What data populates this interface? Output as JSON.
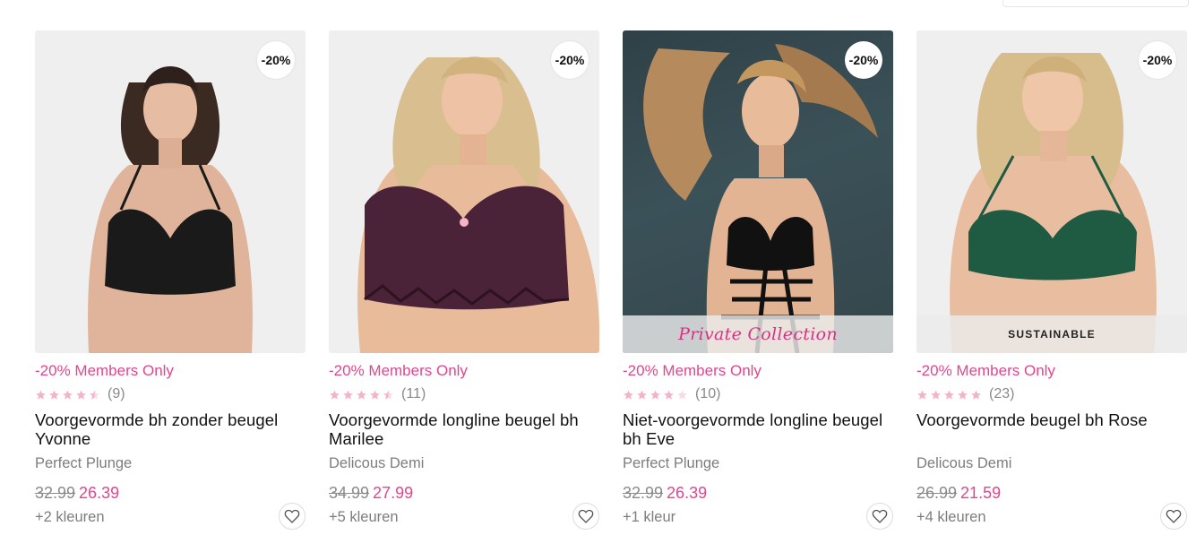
{
  "products": [
    {
      "badge": "-20%",
      "banner": "",
      "promo": "-20% Members Only",
      "rating": 4.5,
      "review_count": "(9)",
      "name": "Voorgevormde bh zonder beugel Yvonne",
      "collection": "Perfect Plunge",
      "old_price": "32.99",
      "new_price": "26.39",
      "colors": "+2 kleuren",
      "bra_color": "#1a1a1a"
    },
    {
      "badge": "-20%",
      "banner": "",
      "promo": "-20% Members Only",
      "rating": 4.5,
      "review_count": "(11)",
      "name": "Voorgevormde longline beugel bh Marilee",
      "collection": "Delicous Demi",
      "old_price": "34.99",
      "new_price": "27.99",
      "colors": "+5 kleuren",
      "bra_color": "#4a2338"
    },
    {
      "badge": "-20%",
      "banner": "Private Collection",
      "promo": "-20% Members Only",
      "rating": 4,
      "review_count": "(10)",
      "name": "Niet-voorgevormde longline beugel bh Eve",
      "collection": "Perfect Plunge",
      "old_price": "32.99",
      "new_price": "26.39",
      "colors": "+1 kleur",
      "bra_color": "#111111"
    },
    {
      "badge": "-20%",
      "banner": "SUSTAINABLE",
      "promo": "-20% Members Only",
      "rating": 5,
      "review_count": "(23)",
      "name": "Voorgevormde beugel bh Rose",
      "collection": "Delicous Demi",
      "old_price": "26.99",
      "new_price": "21.59",
      "colors": "+4 kleuren",
      "bra_color": "#1f5a43"
    }
  ],
  "icons": {
    "wishlist": "heart-icon",
    "rating": "star-icon"
  },
  "colors": {
    "accent": "#e0468f",
    "star_fill": "#f7b3c6",
    "star_empty": "#f4dde4",
    "muted": "#7d7d7d"
  }
}
